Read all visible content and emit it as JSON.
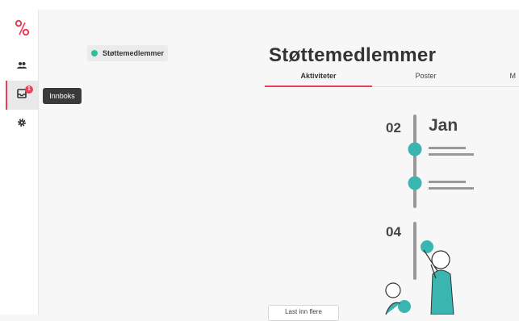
{
  "app": {
    "accent_color": "#e8405a",
    "teal_color": "#3bb5b0"
  },
  "sidebar": {
    "items": [
      {
        "icon": "people-icon"
      },
      {
        "icon": "inbox-icon",
        "badge": "1",
        "tooltip": "Innboks"
      },
      {
        "icon": "gear-icon"
      }
    ]
  },
  "group_chip": {
    "label": "Støttemedlemmer",
    "status_color": "#2bbf9c"
  },
  "main": {
    "title": "Støttemedlemmer",
    "tabs": [
      {
        "label": "Aktiviteter",
        "active": true
      },
      {
        "label": "Poster",
        "active": false
      },
      {
        "label": "M",
        "active": false
      }
    ],
    "load_more_label": "Last inn flere"
  },
  "illustration": {
    "day1": "02",
    "month": "Jan",
    "day2": "04"
  }
}
